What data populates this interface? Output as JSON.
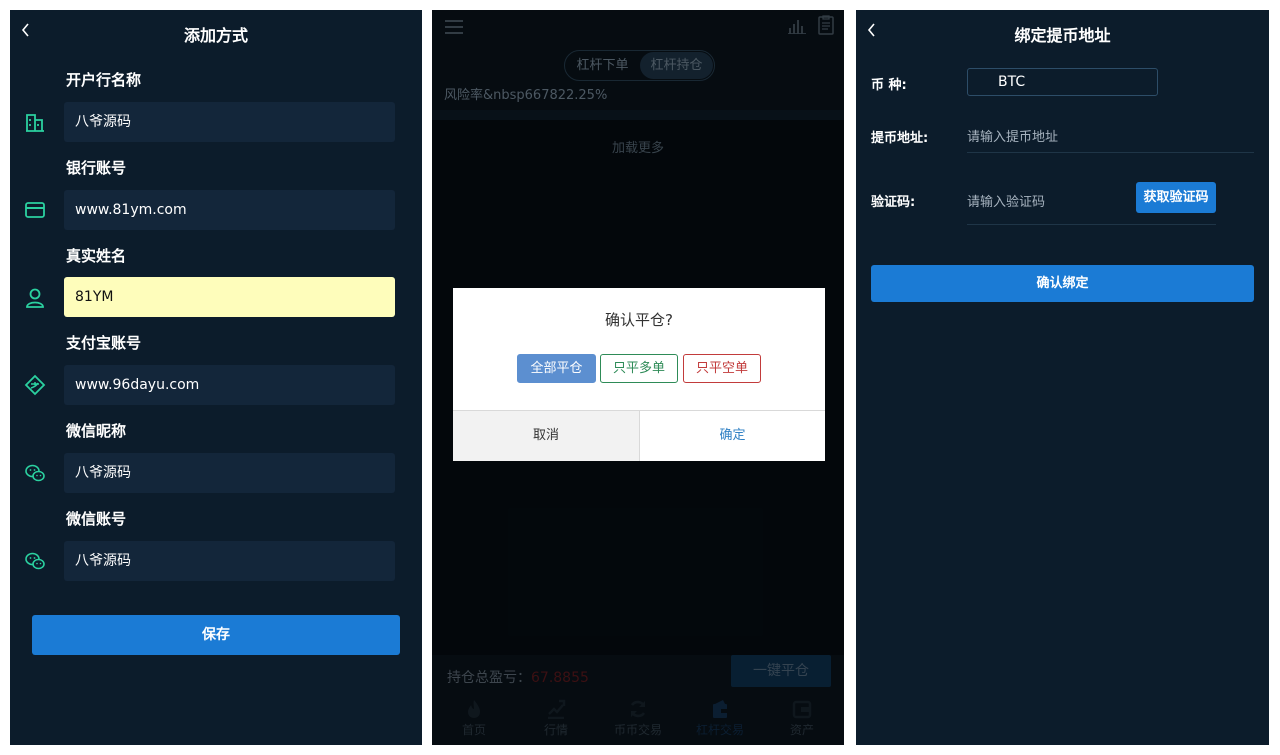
{
  "add_method": {
    "title": "添加方式",
    "fields": [
      {
        "label": "开户行名称",
        "value": "八爷源码",
        "icon": "bank-building-icon"
      },
      {
        "label": "银行账号",
        "value": "www.81ym.com",
        "icon": "card-icon"
      },
      {
        "label": "真实姓名",
        "value": "81YM",
        "icon": "user-icon"
      },
      {
        "label": "支付宝账号",
        "value": "www.96dayu.com",
        "icon": "alipay-icon"
      },
      {
        "label": "微信昵称",
        "value": "八爷源码",
        "icon": "wechat-icon"
      },
      {
        "label": "微信账号",
        "value": "八爷源码",
        "icon": "wechat-icon"
      }
    ],
    "save_label": "保存"
  },
  "leverage": {
    "tabs_top": [
      "杠杆下单",
      "杠杆持仓"
    ],
    "active_top_tab": "杠杆持仓",
    "risk_text": "风险率&nbsp667822.25%",
    "load_more": "加载更多",
    "total_pl_label": "持仓总盈亏：",
    "total_pl_value": "67.8855",
    "close_all_label": "一键平仓",
    "modal": {
      "title": "确认平仓?",
      "buttons": [
        "全部平仓",
        "只平多单",
        "只平空单"
      ],
      "cancel": "取消",
      "confirm": "确定"
    },
    "bottom_tabs": [
      {
        "label": "首页",
        "icon": "flame-icon"
      },
      {
        "label": "行情",
        "icon": "chart-line-icon"
      },
      {
        "label": "币币交易",
        "icon": "refresh-icon"
      },
      {
        "label": "杠杆交易",
        "icon": "wallet-icon"
      },
      {
        "label": "资产",
        "icon": "asset-icon"
      }
    ],
    "active_bottom_tab": "杠杆交易"
  },
  "bind_address": {
    "title": "绑定提币地址",
    "coin_label": "币 种:",
    "coin_value": "BTC",
    "address_label": "提币地址:",
    "address_placeholder": "请输入提币地址",
    "code_label": "验证码:",
    "code_placeholder": "请输入验证码",
    "get_code_label": "获取验证码",
    "confirm_label": "确认绑定"
  },
  "colors": {
    "panel_bg": "#0c1c2b",
    "accent_blue": "#1b7bd5",
    "icon_green": "#2bd1a0",
    "input_highlight": "#fefdbb"
  }
}
